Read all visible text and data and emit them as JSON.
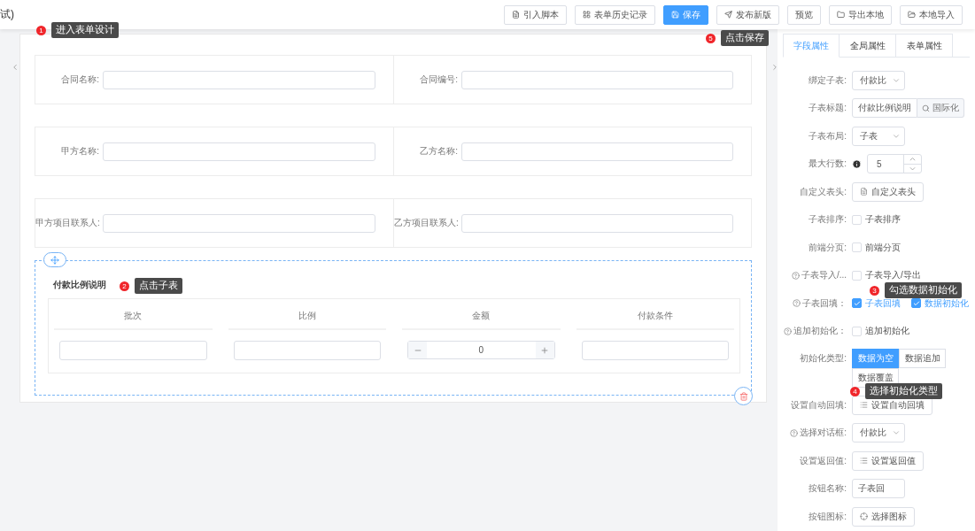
{
  "header": {
    "title": "试)",
    "buttons": [
      {
        "label": "引入脚本",
        "primary": false
      },
      {
        "label": "表单历史记录",
        "primary": false
      },
      {
        "label": "保存",
        "primary": true
      },
      {
        "label": "发布新版",
        "primary": false
      },
      {
        "label": "预览",
        "primary": false
      },
      {
        "label": "导出本地",
        "primary": false
      },
      {
        "label": "本地导入",
        "primary": false
      }
    ]
  },
  "form": {
    "rows": [
      [
        {
          "label": "合同名称:"
        },
        {
          "label": "合同编号:"
        }
      ],
      [
        {
          "label": "甲方名称:"
        },
        {
          "label": "乙方名称:"
        }
      ],
      [
        {
          "label": "甲方项目联系人:"
        },
        {
          "label": "乙方项目联系人:"
        }
      ]
    ],
    "subtable": {
      "title": "付款比例说明",
      "columns": [
        {
          "header": "批次",
          "kind": "text"
        },
        {
          "header": "比例",
          "kind": "text"
        },
        {
          "header": "金额",
          "kind": "number",
          "value": "0"
        },
        {
          "header": "付款条件",
          "kind": "text"
        }
      ]
    }
  },
  "panel": {
    "tabs": [
      {
        "label": "字段属性",
        "selected": true
      },
      {
        "label": "全局属性",
        "selected": false
      },
      {
        "label": "表单属性",
        "selected": false
      }
    ],
    "rows": [
      {
        "label": "绑定子表:",
        "kind": "select",
        "value": "付款比"
      },
      {
        "label": "子表标题:",
        "kind": "input_button",
        "value": "付款比例说明",
        "button": "国际化"
      },
      {
        "label": "子表布局:",
        "kind": "select",
        "value": "子表"
      },
      {
        "label": "最大行数:",
        "kind": "number",
        "value": "5",
        "info": true
      },
      {
        "label": "自定义表头:",
        "kind": "button",
        "button": "自定义表头"
      },
      {
        "label": "子表排序:",
        "kind": "checkbox",
        "checks": [
          {
            "label": "子表排序",
            "checked": false
          }
        ]
      },
      {
        "label": "前端分页:",
        "kind": "checkbox",
        "checks": [
          {
            "label": "前端分页",
            "checked": false
          }
        ]
      },
      {
        "label": "子表导入/...",
        "kind": "checkbox",
        "help": true,
        "checks": [
          {
            "label": "子表导入/导出",
            "checked": false
          }
        ]
      },
      {
        "label": "子表回填：",
        "kind": "checkbox",
        "help": true,
        "checks": [
          {
            "label": "子表回填",
            "checked": true
          },
          {
            "label": "数据初始化",
            "checked": true
          }
        ]
      },
      {
        "label": "追加初始化：",
        "kind": "checkbox",
        "help": true,
        "checks": [
          {
            "label": "追加初始化",
            "checked": false
          }
        ]
      },
      {
        "label": "初始化类型:",
        "kind": "segment",
        "options": [
          {
            "label": "数据为空",
            "selected": true
          },
          {
            "label": "数据追加",
            "selected": false
          },
          {
            "label": "数据覆盖",
            "selected": false
          }
        ]
      },
      {
        "label": "设置自动回填:",
        "kind": "button",
        "button": "设置自动回填"
      },
      {
        "label": "选择对话框:",
        "kind": "select",
        "value": "付款比",
        "help": true
      },
      {
        "label": "设置返回值:",
        "kind": "button",
        "button": "设置返回值"
      },
      {
        "label": "按钮名称:",
        "kind": "input",
        "value": "子表回"
      },
      {
        "label": "按钮图标:",
        "kind": "button",
        "button": "选择图标"
      }
    ]
  },
  "callouts": [
    {
      "number": "1",
      "text": "进入表单设计"
    },
    {
      "number": "5",
      "text": "点击保存"
    },
    {
      "number": "2",
      "text": "点击子表"
    },
    {
      "number": "3",
      "text": "勾选数据初始化"
    },
    {
      "number": "4",
      "text": "选择初始化类型"
    }
  ]
}
